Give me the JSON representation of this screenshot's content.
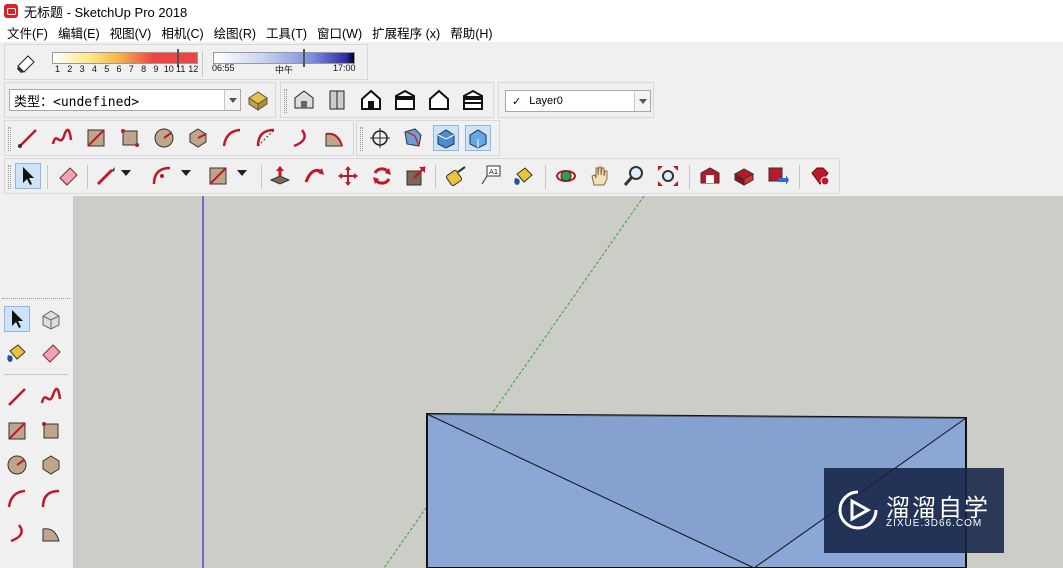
{
  "window": {
    "title": "无标题 - SketchUp Pro 2018"
  },
  "menu": [
    "文件(F)",
    "编辑(E)",
    "视图(V)",
    "相机(C)",
    "绘图(R)",
    "工具(T)",
    "窗口(W)",
    "扩展程序 (x)",
    "帮助(H)"
  ],
  "shadow_bar": {
    "month_numbers": [
      "1",
      "2",
      "3",
      "4",
      "5",
      "6",
      "7",
      "8",
      "9",
      "10",
      "11",
      "12"
    ],
    "time_start": "06:55",
    "time_mid": "中午",
    "time_end": "17:00"
  },
  "type_combo": {
    "value": "类型：<undefined>"
  },
  "layer_combo": {
    "check": "✓",
    "value": "Layer0"
  },
  "watermark": {
    "brand": "溜溜自学",
    "url": "ZIXUE.3D66.COM"
  },
  "colors": {
    "viewport_bg": "#cdcdc8",
    "face": "#8aa7d6",
    "axis_blue": "#2a2ad0",
    "axis_green": "#2ea52e",
    "accent_red": "#c0182a"
  }
}
